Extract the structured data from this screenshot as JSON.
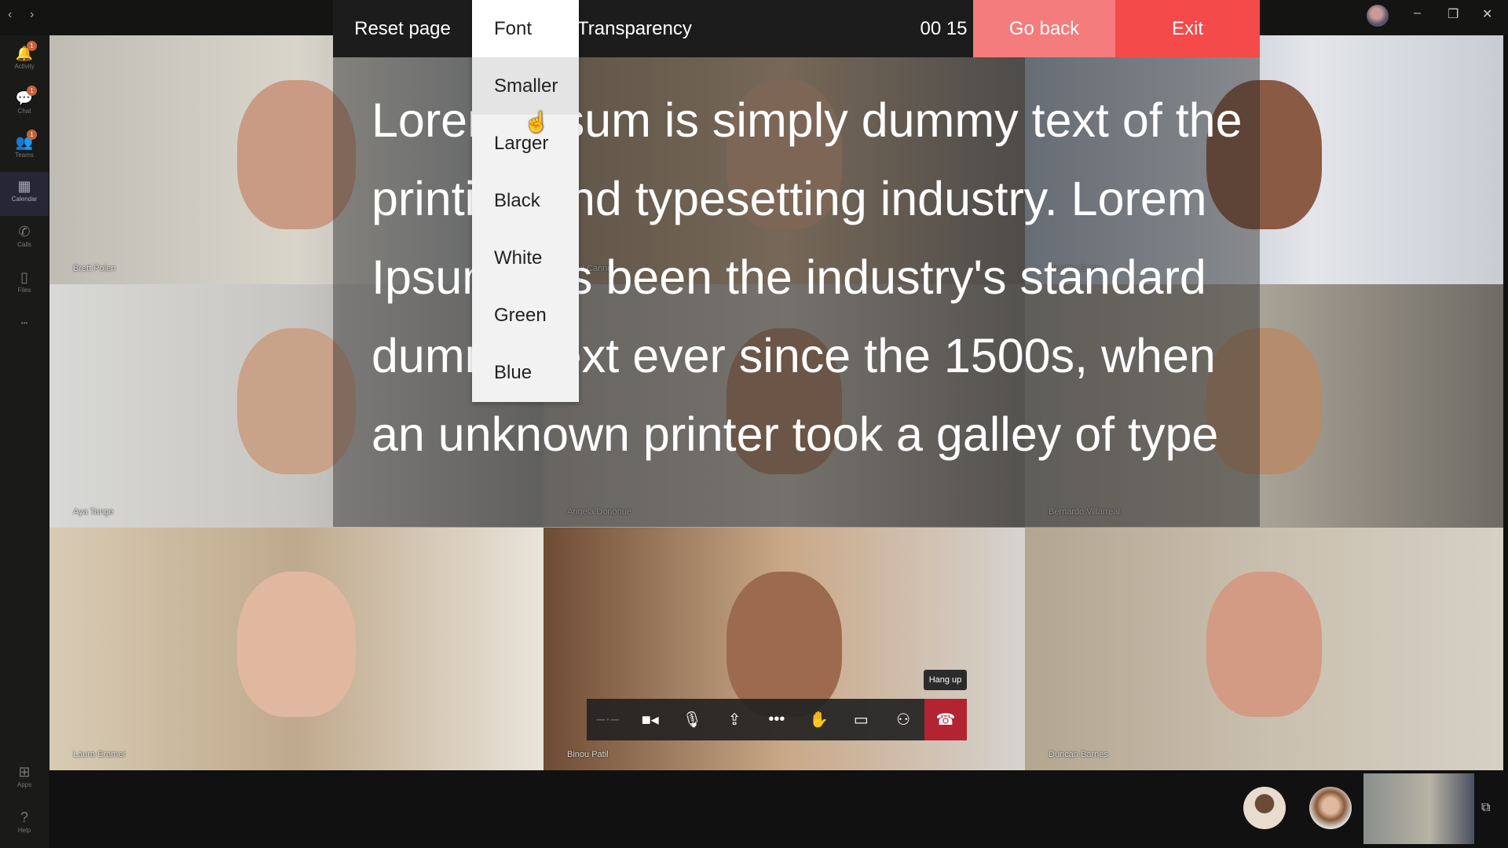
{
  "window": {
    "back_icon": "chevron-left-icon",
    "forward_icon": "chevron-right-icon",
    "minimize": "–",
    "maximize": "❐",
    "close": "✕"
  },
  "rail": {
    "items": [
      {
        "label": "Activity",
        "icon": "bell-icon",
        "glyph": "🔔",
        "badge": "1"
      },
      {
        "label": "Chat",
        "icon": "chat-icon",
        "glyph": "💬",
        "badge": "1"
      },
      {
        "label": "Teams",
        "icon": "teams-icon",
        "glyph": "👥",
        "badge": "1"
      },
      {
        "label": "Calendar",
        "icon": "calendar-icon",
        "glyph": "▦",
        "active": true
      },
      {
        "label": "Calls",
        "icon": "phone-icon",
        "glyph": "✆"
      },
      {
        "label": "Files",
        "icon": "file-icon",
        "glyph": "▯"
      },
      {
        "label": "Apps",
        "icon": "apps-icon",
        "glyph": "⊞"
      },
      {
        "label": "Help",
        "icon": "help-icon",
        "glyph": "?"
      }
    ],
    "more": "•••"
  },
  "participants": [
    "Brett Polen",
    "Paul Cannon",
    "Nivetha Samy",
    "Aya Tange",
    "Angela Donohue",
    "Bernardo Villarreal",
    "Laura Eramer",
    "Binou Patil",
    "Duncan Barnes"
  ],
  "caption_toolbar": {
    "reset": "Reset page",
    "font": "Font",
    "transparency": "Transparency",
    "timer": "00 15",
    "go_back": "Go back",
    "exit": "Exit",
    "go_back_color": "#f47c7c",
    "exit_color": "#f44a4a"
  },
  "font_menu": {
    "items": [
      "Smaller",
      "Larger",
      "Black",
      "White",
      "Green",
      "Blue"
    ],
    "hovered": "Smaller"
  },
  "caption": {
    "text": "Lorem Ipsum is simply dummy text of the printing and typesetting industry. Lorem Ipsum has been the industry's standard dummy text ever since the 1500s, when an unknown printer took a galley of type"
  },
  "call_controls": {
    "tooltip": "Hang up",
    "buttons": [
      {
        "name": "dial-pad",
        "glyph": "–·–"
      },
      {
        "name": "camera",
        "glyph": "■◂"
      },
      {
        "name": "microphone",
        "glyph": "🎙"
      },
      {
        "name": "share-screen",
        "glyph": "⇪"
      },
      {
        "name": "more",
        "glyph": "•••"
      },
      {
        "name": "raise-hand",
        "glyph": "✋"
      },
      {
        "name": "chat",
        "glyph": "▭"
      },
      {
        "name": "participants",
        "glyph": "⚇"
      },
      {
        "name": "hang-up",
        "glyph": "☎"
      }
    ]
  }
}
